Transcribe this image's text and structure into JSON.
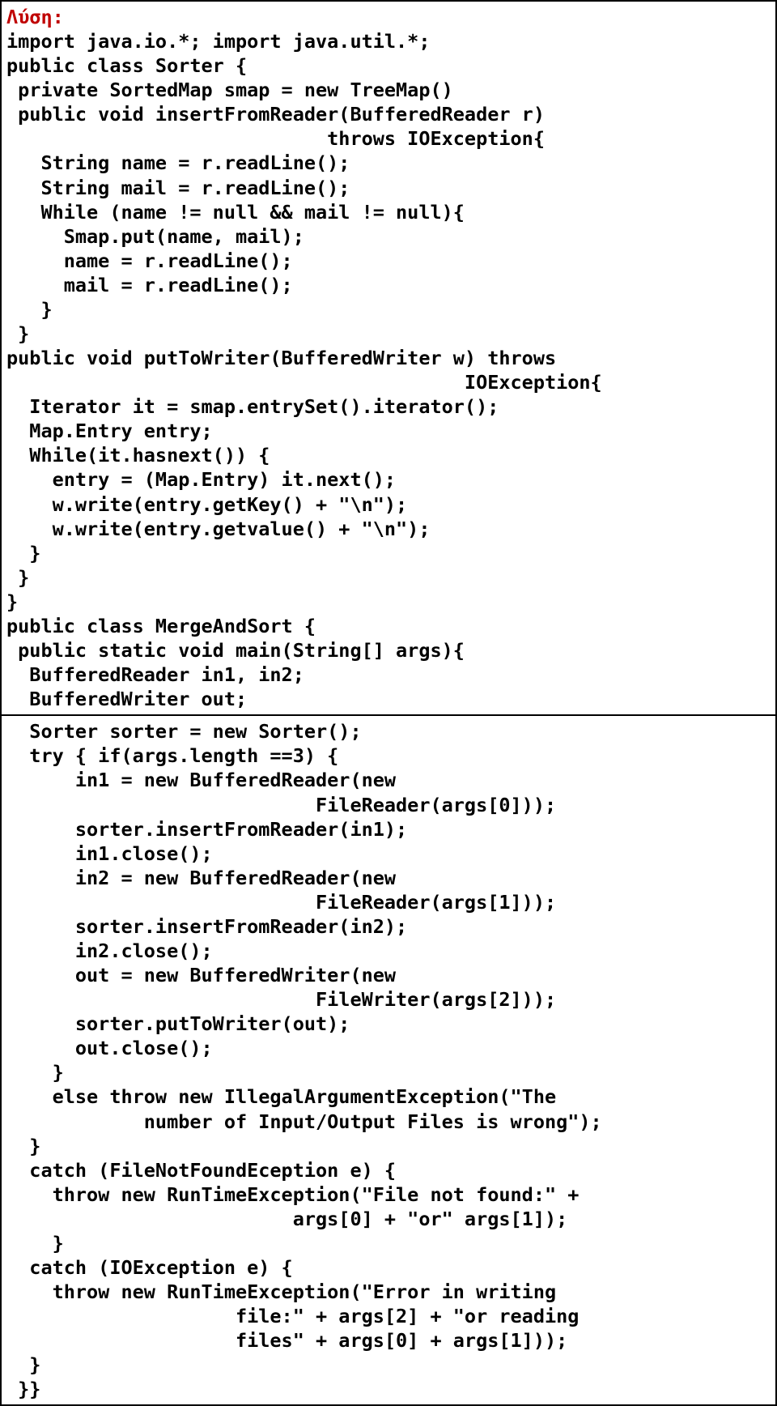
{
  "heading": "Λύση:",
  "code_top": "import java.io.*; import java.util.*;\npublic class Sorter {\n private SortedMap smap = new TreeMap()\n public void insertFromReader(BufferedReader r)\n                            throws IOException{\n   String name = r.readLine();\n   String mail = r.readLine();\n   While (name != null && mail != null){\n     Smap.put(name, mail);\n     name = r.readLine();\n     mail = r.readLine();\n   }\n }\npublic void putToWriter(BufferedWriter w) throws\n                                        IOException{\n  Iterator it = smap.entrySet().iterator();\n  Map.Entry entry;\n  While(it.hasnext()) {\n    entry = (Map.Entry) it.next();\n    w.write(entry.getKey() + \"\\n\");\n    w.write(entry.getvalue() + \"\\n\");\n  }\n }\n}\npublic class MergeAndSort {\n public static void main(String[] args){\n  BufferedReader in1, in2;\n  BufferedWriter out;",
  "code_bottom": "  Sorter sorter = new Sorter();\n  try { if(args.length ==3) {\n      in1 = new BufferedReader(new\n                           FileReader(args[0]));\n      sorter.insertFromReader(in1);\n      in1.close();\n      in2 = new BufferedReader(new\n                           FileReader(args[1]));\n      sorter.insertFromReader(in2);\n      in2.close();\n      out = new BufferedWriter(new\n                           FileWriter(args[2]));\n      sorter.putToWriter(out);\n      out.close();\n    }\n    else throw new IllegalArgumentException(\"The\n            number of Input/Output Files is wrong\");\n  }\n  catch (FileNotFoundEception e) {\n    throw new RunTimeException(\"File not found:\" +\n                         args[0] + \"or\" args[1]);\n    }\n  catch (IOException e) {\n    throw new RunTimeException(\"Error in writing\n                    file:\" + args[2] + \"or reading\n                    files\" + args[0] + args[1]));\n  }\n }}"
}
